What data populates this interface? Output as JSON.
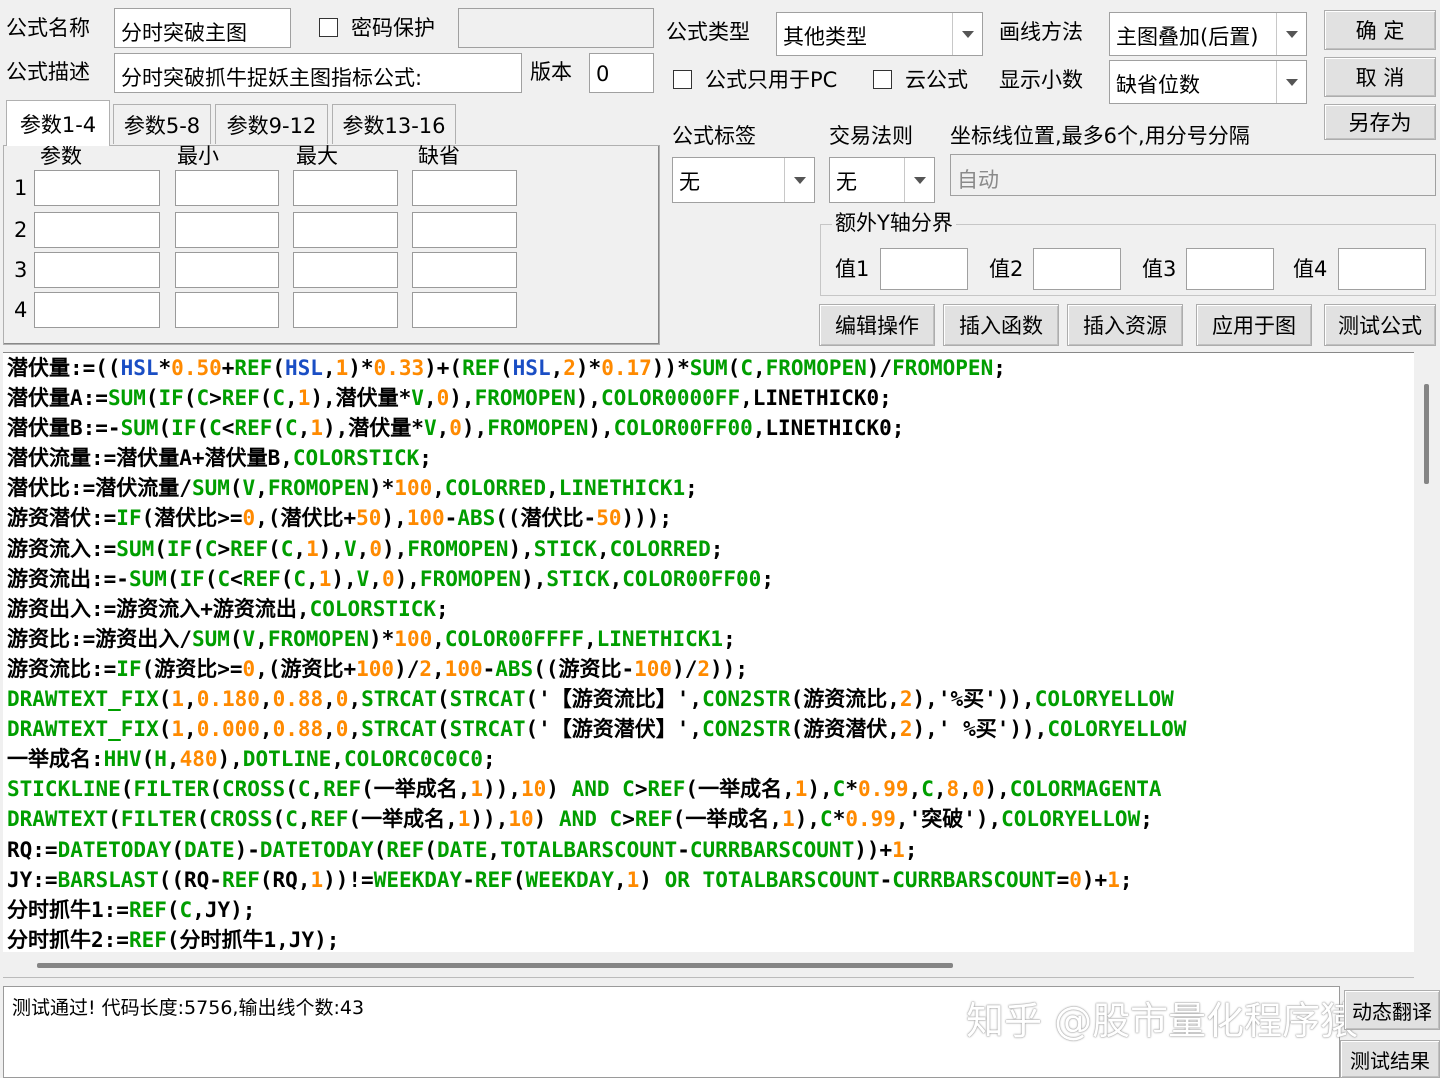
{
  "header": {
    "name_label": "公式名称",
    "name_value": "分时突破主图",
    "password_label": "密码保护",
    "type_label": "公式类型",
    "type_value": "其他类型",
    "draw_label": "画线方法",
    "draw_value": "主图叠加(后置)",
    "desc_label": "公式描述",
    "desc_value": "分时突破抓牛捉妖主图指标公式:",
    "version_label": "版本",
    "version_value": "0",
    "pc_only_label": "公式只用于PC",
    "cloud_label": "云公式",
    "decimals_label": "显示小数",
    "decimals_value": "缺省位数"
  },
  "buttons": {
    "ok": "确  定",
    "cancel": "取  消",
    "save_as": "另存为",
    "edit_ops": "编辑操作",
    "insert_func": "插入函数",
    "insert_res": "插入资源",
    "apply_chart": "应用于图",
    "test_formula": "测试公式",
    "translate": "动态翻译",
    "test_result": "测试结果"
  },
  "params": {
    "tabs": [
      "参数1-4",
      "参数5-8",
      "参数9-12",
      "参数13-16"
    ],
    "columns": [
      "参数",
      "最小",
      "最大",
      "缺省"
    ],
    "rows": [
      "1",
      "2",
      "3",
      "4"
    ]
  },
  "right_panel": {
    "tag_label": "公式标签",
    "tag_value": "无",
    "rule_label": "交易法则",
    "rule_value": "无",
    "axis_label": "坐标线位置,最多6个,用分号分隔",
    "axis_value": "自动",
    "extra_group_label": "额外Y轴分界",
    "val1_label": "值1",
    "val2_label": "值2",
    "val3_label": "值3",
    "val4_label": "值4"
  },
  "code_lines": [
    [
      [
        "潜伏量:=((",
        "id"
      ],
      [
        "HSL",
        "kw"
      ],
      [
        "*",
        "id"
      ],
      [
        "0.50",
        "num"
      ],
      [
        "+",
        "id"
      ],
      [
        "REF",
        "fn"
      ],
      [
        "(",
        "id"
      ],
      [
        "HSL",
        "kw"
      ],
      [
        ",",
        "id"
      ],
      [
        "1",
        "num"
      ],
      [
        ")*",
        "id"
      ],
      [
        "0.33",
        "num"
      ],
      [
        ")+(",
        "id"
      ],
      [
        "REF",
        "fn"
      ],
      [
        "(",
        "id"
      ],
      [
        "HSL",
        "kw"
      ],
      [
        ",",
        "id"
      ],
      [
        "2",
        "num"
      ],
      [
        ")*",
        "id"
      ],
      [
        "0.17",
        "num"
      ],
      [
        "))*",
        "id"
      ],
      [
        "SUM",
        "fn"
      ],
      [
        "(",
        "id"
      ],
      [
        "C",
        "fn"
      ],
      [
        ",",
        "id"
      ],
      [
        "FROMOPEN",
        "fn"
      ],
      [
        ")/",
        "id"
      ],
      [
        "FROMOPEN",
        "fn"
      ],
      [
        ";",
        "id"
      ]
    ],
    [
      [
        "潜伏量A:=",
        "id"
      ],
      [
        "SUM",
        "fn"
      ],
      [
        "(",
        "id"
      ],
      [
        "IF",
        "fn"
      ],
      [
        "(",
        "id"
      ],
      [
        "C",
        "fn"
      ],
      [
        ">",
        "id"
      ],
      [
        "REF",
        "fn"
      ],
      [
        "(",
        "id"
      ],
      [
        "C",
        "fn"
      ],
      [
        ",",
        "id"
      ],
      [
        "1",
        "num"
      ],
      [
        "),潜伏量*",
        "id"
      ],
      [
        "V",
        "fn"
      ],
      [
        ",",
        "id"
      ],
      [
        "0",
        "num"
      ],
      [
        "),",
        "id"
      ],
      [
        "FROMOPEN",
        "fn"
      ],
      [
        "),",
        "id"
      ],
      [
        "COLOR0000FF",
        "fn"
      ],
      [
        ",LINETHICK0;",
        "id"
      ]
    ],
    [
      [
        "潜伏量B:=-",
        "id"
      ],
      [
        "SUM",
        "fn"
      ],
      [
        "(",
        "id"
      ],
      [
        "IF",
        "fn"
      ],
      [
        "(",
        "id"
      ],
      [
        "C",
        "fn"
      ],
      [
        "<",
        "id"
      ],
      [
        "REF",
        "fn"
      ],
      [
        "(",
        "id"
      ],
      [
        "C",
        "fn"
      ],
      [
        ",",
        "id"
      ],
      [
        "1",
        "num"
      ],
      [
        "),潜伏量*",
        "id"
      ],
      [
        "V",
        "fn"
      ],
      [
        ",",
        "id"
      ],
      [
        "0",
        "num"
      ],
      [
        "),",
        "id"
      ],
      [
        "FROMOPEN",
        "fn"
      ],
      [
        "),",
        "id"
      ],
      [
        "COLOR00FF00",
        "fn"
      ],
      [
        ",LINETHICK0;",
        "id"
      ]
    ],
    [
      [
        "潜伏流量:=潜伏量A+潜伏量B,",
        "id"
      ],
      [
        "COLORSTICK",
        "fn"
      ],
      [
        ";",
        "id"
      ]
    ],
    [
      [
        "潜伏比:=潜伏流量/",
        "id"
      ],
      [
        "SUM",
        "fn"
      ],
      [
        "(",
        "id"
      ],
      [
        "V",
        "fn"
      ],
      [
        ",",
        "id"
      ],
      [
        "FROMOPEN",
        "fn"
      ],
      [
        ")*",
        "id"
      ],
      [
        "100",
        "num"
      ],
      [
        ",",
        "id"
      ],
      [
        "COLORRED",
        "fn"
      ],
      [
        ",",
        "id"
      ],
      [
        "LINETHICK1",
        "fn"
      ],
      [
        ";",
        "id"
      ]
    ],
    [
      [
        "游资潜伏:=",
        "id"
      ],
      [
        "IF",
        "fn"
      ],
      [
        "(潜伏比>=",
        "id"
      ],
      [
        "0",
        "num"
      ],
      [
        ",(潜伏比+",
        "id"
      ],
      [
        "50",
        "num"
      ],
      [
        "),",
        "id"
      ],
      [
        "100",
        "num"
      ],
      [
        "-",
        "id"
      ],
      [
        "ABS",
        "fn"
      ],
      [
        "((潜伏比-",
        "id"
      ],
      [
        "50",
        "num"
      ],
      [
        ")));",
        "id"
      ]
    ],
    [
      [
        "游资流入:=",
        "id"
      ],
      [
        "SUM",
        "fn"
      ],
      [
        "(",
        "id"
      ],
      [
        "IF",
        "fn"
      ],
      [
        "(",
        "id"
      ],
      [
        "C",
        "fn"
      ],
      [
        ">",
        "id"
      ],
      [
        "REF",
        "fn"
      ],
      [
        "(",
        "id"
      ],
      [
        "C",
        "fn"
      ],
      [
        ",",
        "id"
      ],
      [
        "1",
        "num"
      ],
      [
        "),",
        "id"
      ],
      [
        "V",
        "fn"
      ],
      [
        ",",
        "id"
      ],
      [
        "0",
        "num"
      ],
      [
        "),",
        "id"
      ],
      [
        "FROMOPEN",
        "fn"
      ],
      [
        "),",
        "id"
      ],
      [
        "STICK",
        "fn"
      ],
      [
        ",",
        "id"
      ],
      [
        "COLORRED",
        "fn"
      ],
      [
        ";",
        "id"
      ]
    ],
    [
      [
        "游资流出:=-",
        "id"
      ],
      [
        "SUM",
        "fn"
      ],
      [
        "(",
        "id"
      ],
      [
        "IF",
        "fn"
      ],
      [
        "(",
        "id"
      ],
      [
        "C",
        "fn"
      ],
      [
        "<",
        "id"
      ],
      [
        "REF",
        "fn"
      ],
      [
        "(",
        "id"
      ],
      [
        "C",
        "fn"
      ],
      [
        ",",
        "id"
      ],
      [
        "1",
        "num"
      ],
      [
        "),",
        "id"
      ],
      [
        "V",
        "fn"
      ],
      [
        ",",
        "id"
      ],
      [
        "0",
        "num"
      ],
      [
        "),",
        "id"
      ],
      [
        "FROMOPEN",
        "fn"
      ],
      [
        "),",
        "id"
      ],
      [
        "STICK",
        "fn"
      ],
      [
        ",",
        "id"
      ],
      [
        "COLOR00FF00",
        "fn"
      ],
      [
        ";",
        "id"
      ]
    ],
    [
      [
        "游资出入:=游资流入+游资流出,",
        "id"
      ],
      [
        "COLORSTICK",
        "fn"
      ],
      [
        ";",
        "id"
      ]
    ],
    [
      [
        "游资比:=游资出入/",
        "id"
      ],
      [
        "SUM",
        "fn"
      ],
      [
        "(",
        "id"
      ],
      [
        "V",
        "fn"
      ],
      [
        ",",
        "id"
      ],
      [
        "FROMOPEN",
        "fn"
      ],
      [
        ")*",
        "id"
      ],
      [
        "100",
        "num"
      ],
      [
        ",",
        "id"
      ],
      [
        "COLOR00FFFF",
        "fn"
      ],
      [
        ",",
        "id"
      ],
      [
        "LINETHICK1",
        "fn"
      ],
      [
        ";",
        "id"
      ]
    ],
    [
      [
        "游资流比:=",
        "id"
      ],
      [
        "IF",
        "fn"
      ],
      [
        "(游资比>=",
        "id"
      ],
      [
        "0",
        "num"
      ],
      [
        ",(游资比+",
        "id"
      ],
      [
        "100",
        "num"
      ],
      [
        ")/",
        "id"
      ],
      [
        "2",
        "num"
      ],
      [
        ",",
        "id"
      ],
      [
        "100",
        "num"
      ],
      [
        "-",
        "id"
      ],
      [
        "ABS",
        "fn"
      ],
      [
        "((游资比-",
        "id"
      ],
      [
        "100",
        "num"
      ],
      [
        ")/",
        "id"
      ],
      [
        "2",
        "num"
      ],
      [
        "));",
        "id"
      ]
    ],
    [
      [
        "DRAWTEXT_FIX",
        "fn"
      ],
      [
        "(",
        "id"
      ],
      [
        "1",
        "num"
      ],
      [
        ",",
        "id"
      ],
      [
        "0.180",
        "num"
      ],
      [
        ",",
        "id"
      ],
      [
        "0.88",
        "num"
      ],
      [
        ",",
        "id"
      ],
      [
        "0",
        "num"
      ],
      [
        ",",
        "id"
      ],
      [
        "STRCAT",
        "fn"
      ],
      [
        "(",
        "id"
      ],
      [
        "STRCAT",
        "fn"
      ],
      [
        "('【游资流比】',",
        "id"
      ],
      [
        "CON2STR",
        "fn"
      ],
      [
        "(游资流比,",
        "id"
      ],
      [
        "2",
        "num"
      ],
      [
        "),'%买')),",
        "id"
      ],
      [
        "COLORYELLOW",
        "fn"
      ]
    ],
    [
      [
        "DRAWTEXT_FIX",
        "fn"
      ],
      [
        "(",
        "id"
      ],
      [
        "1",
        "num"
      ],
      [
        ",",
        "id"
      ],
      [
        "0.000",
        "num"
      ],
      [
        ",",
        "id"
      ],
      [
        "0.88",
        "num"
      ],
      [
        ",",
        "id"
      ],
      [
        "0",
        "num"
      ],
      [
        ",",
        "id"
      ],
      [
        "STRCAT",
        "fn"
      ],
      [
        "(",
        "id"
      ],
      [
        "STRCAT",
        "fn"
      ],
      [
        "('【游资潜伏】',",
        "id"
      ],
      [
        "CON2STR",
        "fn"
      ],
      [
        "(游资潜伏,",
        "id"
      ],
      [
        "2",
        "num"
      ],
      [
        "),' %买')),",
        "id"
      ],
      [
        "COLORYELLOW",
        "fn"
      ]
    ],
    [
      [
        "一举成名:",
        "id"
      ],
      [
        "HHV",
        "fn"
      ],
      [
        "(",
        "id"
      ],
      [
        "H",
        "fn"
      ],
      [
        ",",
        "id"
      ],
      [
        "480",
        "num"
      ],
      [
        "),",
        "id"
      ],
      [
        "DOTLINE",
        "fn"
      ],
      [
        ",",
        "id"
      ],
      [
        "COLORC0C0C0",
        "fn"
      ],
      [
        ";",
        "id"
      ]
    ],
    [
      [
        "STICKLINE",
        "fn"
      ],
      [
        "(",
        "id"
      ],
      [
        "FILTER",
        "fn"
      ],
      [
        "(",
        "id"
      ],
      [
        "CROSS",
        "fn"
      ],
      [
        "(",
        "id"
      ],
      [
        "C",
        "fn"
      ],
      [
        ",",
        "id"
      ],
      [
        "REF",
        "fn"
      ],
      [
        "(一举成名,",
        "id"
      ],
      [
        "1",
        "num"
      ],
      [
        ")),",
        "id"
      ],
      [
        "10",
        "num"
      ],
      [
        ") ",
        "id"
      ],
      [
        "AND",
        "fn"
      ],
      [
        " ",
        "id"
      ],
      [
        "C",
        "fn"
      ],
      [
        ">",
        "id"
      ],
      [
        "REF",
        "fn"
      ],
      [
        "(一举成名,",
        "id"
      ],
      [
        "1",
        "num"
      ],
      [
        "),",
        "id"
      ],
      [
        "C",
        "fn"
      ],
      [
        "*",
        "id"
      ],
      [
        "0.99",
        "num"
      ],
      [
        ",",
        "id"
      ],
      [
        "C",
        "fn"
      ],
      [
        ",",
        "id"
      ],
      [
        "8",
        "num"
      ],
      [
        ",",
        "id"
      ],
      [
        "0",
        "num"
      ],
      [
        "),",
        "id"
      ],
      [
        "COLORMAGENTA",
        "fn"
      ]
    ],
    [
      [
        "DRAWTEXT",
        "fn"
      ],
      [
        "(",
        "id"
      ],
      [
        "FILTER",
        "fn"
      ],
      [
        "(",
        "id"
      ],
      [
        "CROSS",
        "fn"
      ],
      [
        "(",
        "id"
      ],
      [
        "C",
        "fn"
      ],
      [
        ",",
        "id"
      ],
      [
        "REF",
        "fn"
      ],
      [
        "(一举成名,",
        "id"
      ],
      [
        "1",
        "num"
      ],
      [
        ")),",
        "id"
      ],
      [
        "10",
        "num"
      ],
      [
        ") ",
        "id"
      ],
      [
        "AND",
        "fn"
      ],
      [
        " ",
        "id"
      ],
      [
        "C",
        "fn"
      ],
      [
        ">",
        "id"
      ],
      [
        "REF",
        "fn"
      ],
      [
        "(一举成名,",
        "id"
      ],
      [
        "1",
        "num"
      ],
      [
        "),",
        "id"
      ],
      [
        "C",
        "fn"
      ],
      [
        "*",
        "id"
      ],
      [
        "0.99",
        "num"
      ],
      [
        ",'突破'),",
        "id"
      ],
      [
        "COLORYELLOW",
        "fn"
      ],
      [
        ";",
        "id"
      ]
    ],
    [
      [
        "RQ:=",
        "id"
      ],
      [
        "DATETODAY",
        "fn"
      ],
      [
        "(",
        "id"
      ],
      [
        "DATE",
        "fn"
      ],
      [
        ")-",
        "id"
      ],
      [
        "DATETODAY",
        "fn"
      ],
      [
        "(",
        "id"
      ],
      [
        "REF",
        "fn"
      ],
      [
        "(",
        "id"
      ],
      [
        "DATE",
        "fn"
      ],
      [
        ",",
        "id"
      ],
      [
        "TOTALBARSCOUNT",
        "fn"
      ],
      [
        "-",
        "id"
      ],
      [
        "CURRBARSCOUNT",
        "fn"
      ],
      [
        "))+",
        "id"
      ],
      [
        "1",
        "num"
      ],
      [
        ";",
        "id"
      ]
    ],
    [
      [
        "JY:=",
        "id"
      ],
      [
        "BARSLAST",
        "fn"
      ],
      [
        "((RQ-",
        "id"
      ],
      [
        "REF",
        "fn"
      ],
      [
        "(RQ,",
        "id"
      ],
      [
        "1",
        "num"
      ],
      [
        "))!=",
        "id"
      ],
      [
        "WEEKDAY",
        "fn"
      ],
      [
        "-",
        "id"
      ],
      [
        "REF",
        "fn"
      ],
      [
        "(",
        "id"
      ],
      [
        "WEEKDAY",
        "fn"
      ],
      [
        ",",
        "id"
      ],
      [
        "1",
        "num"
      ],
      [
        ") ",
        "id"
      ],
      [
        "OR",
        "fn"
      ],
      [
        " ",
        "id"
      ],
      [
        "TOTALBARSCOUNT",
        "fn"
      ],
      [
        "-",
        "id"
      ],
      [
        "CURRBARSCOUNT",
        "fn"
      ],
      [
        "=",
        "id"
      ],
      [
        "0",
        "num"
      ],
      [
        ")+",
        "id"
      ],
      [
        "1",
        "num"
      ],
      [
        ";",
        "id"
      ]
    ],
    [
      [
        "分时抓牛1:=",
        "id"
      ],
      [
        "REF",
        "fn"
      ],
      [
        "(",
        "id"
      ],
      [
        "C",
        "fn"
      ],
      [
        ",JY);",
        "id"
      ]
    ],
    [
      [
        "分时抓牛2:=",
        "id"
      ],
      [
        "REF",
        "fn"
      ],
      [
        "(分时抓牛1,JY);",
        "id"
      ]
    ]
  ],
  "status_text": "测试通过! 代码长度:5756,输出线个数:43",
  "watermark": "知乎 @股市量化程序猿",
  "colors": {
    "code_default": "#000000",
    "code_function": "#009e00",
    "code_keyword": "#1a4ec4",
    "code_number": "#ff8a00"
  }
}
